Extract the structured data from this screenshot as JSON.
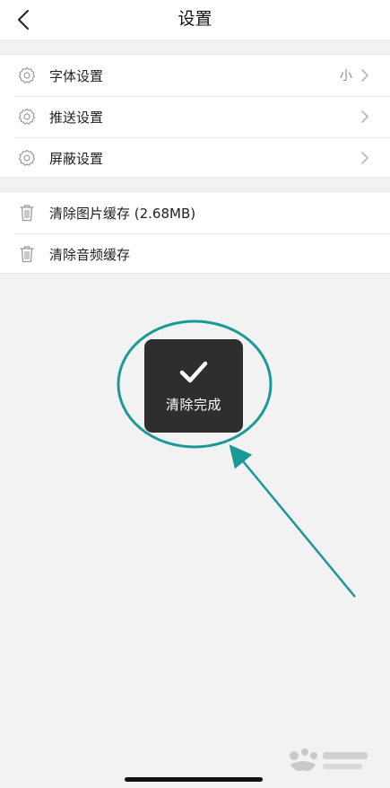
{
  "nav": {
    "title": "设置",
    "back_icon": "chevron-left-icon"
  },
  "settings_group": {
    "items": [
      {
        "label": "字体设置",
        "value": "小",
        "icon": "gear-icon"
      },
      {
        "label": "推送设置",
        "value": "",
        "icon": "gear-icon"
      },
      {
        "label": "屏蔽设置",
        "value": "",
        "icon": "gear-icon"
      }
    ]
  },
  "cache_group": {
    "items": [
      {
        "label": "清除图片缓存 (2.68MB)",
        "icon": "trash-icon"
      },
      {
        "label": "清除音频缓存",
        "icon": "trash-icon"
      }
    ]
  },
  "toast": {
    "text": "清除完成",
    "icon": "checkmark-icon"
  },
  "annotation": {
    "color": "#1a9a96"
  },
  "colors": {
    "background": "#f2f2f2",
    "toast_bg": "#2e2e2e"
  }
}
